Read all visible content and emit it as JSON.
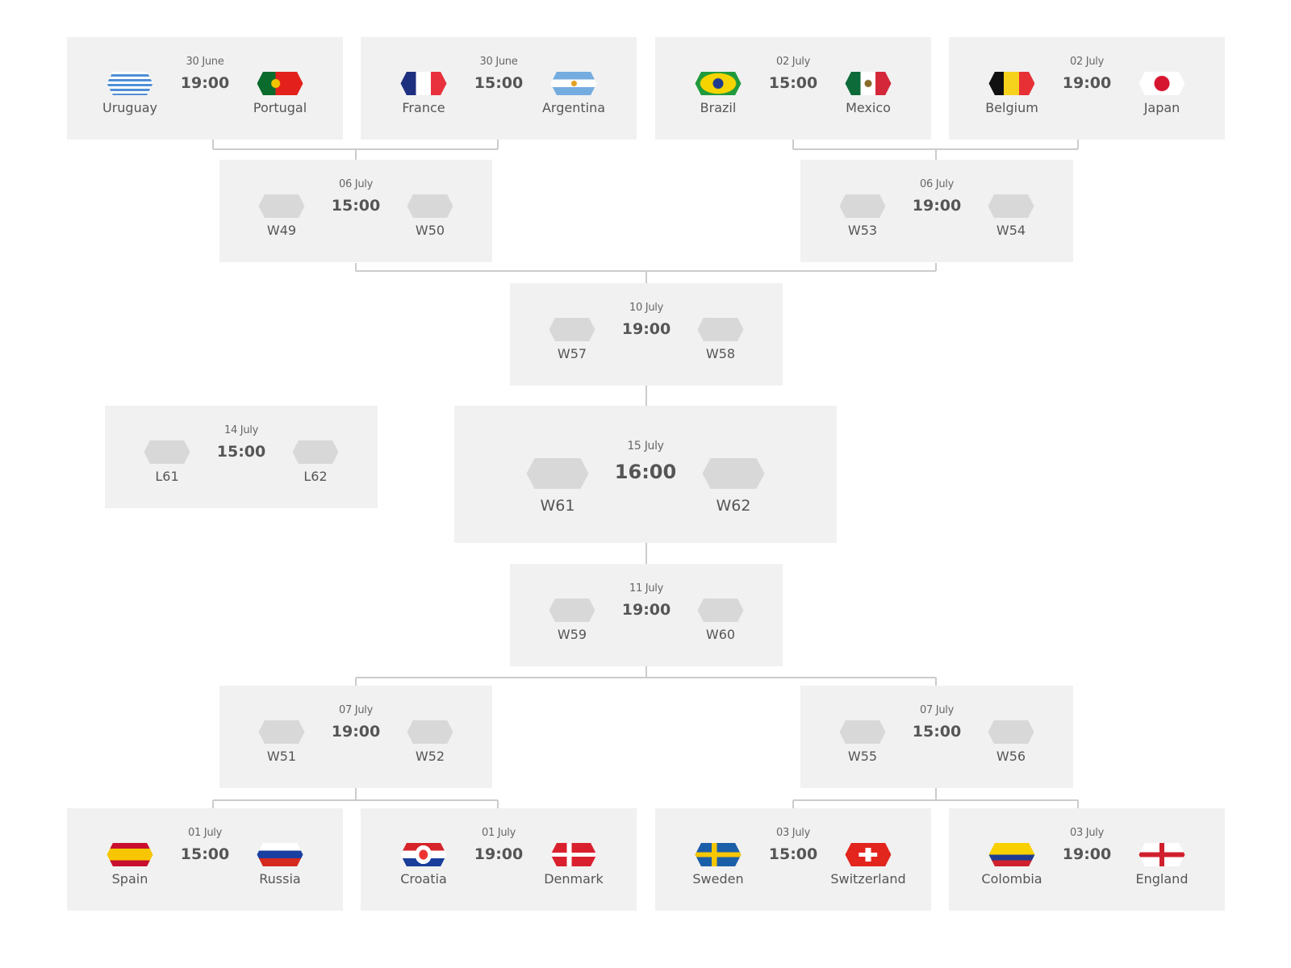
{
  "matches": [
    {
      "id": "r16-1",
      "date": "30 June",
      "time": "19:00",
      "home": {
        "name": "Uruguay",
        "flag": "uruguay"
      },
      "away": {
        "name": "Portugal",
        "flag": "portugal"
      }
    },
    {
      "id": "r16-2",
      "date": "30 June",
      "time": "15:00",
      "home": {
        "name": "France",
        "flag": "france"
      },
      "away": {
        "name": "Argentina",
        "flag": "argentina"
      }
    },
    {
      "id": "r16-3",
      "date": "02 July",
      "time": "15:00",
      "home": {
        "name": "Brazil",
        "flag": "brazil"
      },
      "away": {
        "name": "Mexico",
        "flag": "mexico"
      }
    },
    {
      "id": "r16-4",
      "date": "02 July",
      "time": "19:00",
      "home": {
        "name": "Belgium",
        "flag": "belgium"
      },
      "away": {
        "name": "Japan",
        "flag": "japan"
      }
    },
    {
      "id": "qf-1",
      "date": "06 July",
      "time": "15:00",
      "home": {
        "name": "W49",
        "flag": "placeholder"
      },
      "away": {
        "name": "W50",
        "flag": "placeholder"
      }
    },
    {
      "id": "qf-2",
      "date": "06 July",
      "time": "19:00",
      "home": {
        "name": "W53",
        "flag": "placeholder"
      },
      "away": {
        "name": "W54",
        "flag": "placeholder"
      }
    },
    {
      "id": "sf-1",
      "date": "10 July",
      "time": "19:00",
      "home": {
        "name": "W57",
        "flag": "placeholder"
      },
      "away": {
        "name": "W58",
        "flag": "placeholder"
      }
    },
    {
      "id": "third",
      "date": "14 July",
      "time": "15:00",
      "home": {
        "name": "L61",
        "flag": "placeholder"
      },
      "away": {
        "name": "L62",
        "flag": "placeholder"
      }
    },
    {
      "id": "final",
      "date": "15 July",
      "time": "16:00",
      "home": {
        "name": "W61",
        "flag": "placeholder"
      },
      "away": {
        "name": "W62",
        "flag": "placeholder"
      }
    },
    {
      "id": "sf-2",
      "date": "11 July",
      "time": "19:00",
      "home": {
        "name": "W59",
        "flag": "placeholder"
      },
      "away": {
        "name": "W60",
        "flag": "placeholder"
      }
    },
    {
      "id": "qf-3",
      "date": "07 July",
      "time": "19:00",
      "home": {
        "name": "W51",
        "flag": "placeholder"
      },
      "away": {
        "name": "W52",
        "flag": "placeholder"
      }
    },
    {
      "id": "qf-4",
      "date": "07 July",
      "time": "15:00",
      "home": {
        "name": "W55",
        "flag": "placeholder"
      },
      "away": {
        "name": "W56",
        "flag": "placeholder"
      }
    },
    {
      "id": "r16-5",
      "date": "01 July",
      "time": "15:00",
      "home": {
        "name": "Spain",
        "flag": "spain"
      },
      "away": {
        "name": "Russia",
        "flag": "russia"
      }
    },
    {
      "id": "r16-6",
      "date": "01 July",
      "time": "19:00",
      "home": {
        "name": "Croatia",
        "flag": "croatia"
      },
      "away": {
        "name": "Denmark",
        "flag": "denmark"
      }
    },
    {
      "id": "r16-7",
      "date": "03 July",
      "time": "15:00",
      "home": {
        "name": "Sweden",
        "flag": "sweden"
      },
      "away": {
        "name": "Switzerland",
        "flag": "switzerland"
      }
    },
    {
      "id": "r16-8",
      "date": "03 July",
      "time": "19:00",
      "home": {
        "name": "Colombia",
        "flag": "colombia"
      },
      "away": {
        "name": "England",
        "flag": "england"
      }
    }
  ],
  "colors": {
    "card": "#f1f1f1",
    "connector": "#cccccc",
    "placeholder": "#d8d8d8",
    "text": "#555555"
  }
}
